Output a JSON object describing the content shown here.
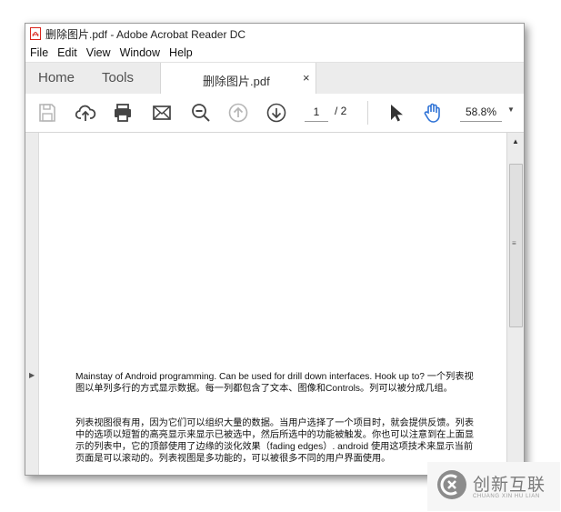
{
  "window": {
    "title": "删除图片.pdf - Adobe Acrobat Reader DC"
  },
  "menu": [
    "File",
    "Edit",
    "View",
    "Window",
    "Help"
  ],
  "tabs": {
    "home": "Home",
    "tools": "Tools",
    "document": "删除图片.pdf",
    "close": "×"
  },
  "toolbar": {
    "current_page": "1",
    "page_separator": "/ 2",
    "zoom": "58.8%"
  },
  "document": {
    "paragraphs": [
      "Mainstay of Android programming. Can be used for drill down interfaces. Hook up to? 一个列表视图以单列多行的方式显示数据。每一列都包含了文本、图像和Controls。列可以被分成几组。",
      "列表视图很有用，因为它们可以组织大量的数据。当用户选择了一个项目时，就会提供反馈。列表中的选项以短暂的高亮显示来显示已被选中，然后所选中的功能被触发。你也可以注意到在上面显示的列表中，它的顶部使用了边缘的淡化效果（fading edges）. android 使用这项技术来显示当前页面是可以滚动的。列表视图是多功能的，可以被很多不同的用户界面使用。"
    ]
  },
  "watermark": {
    "title": "创新互联",
    "subtitle": "CHUANG XIN HU LIAN"
  },
  "colors": {
    "accent": "#2f73d6",
    "pdf_red": "#d9251d"
  }
}
